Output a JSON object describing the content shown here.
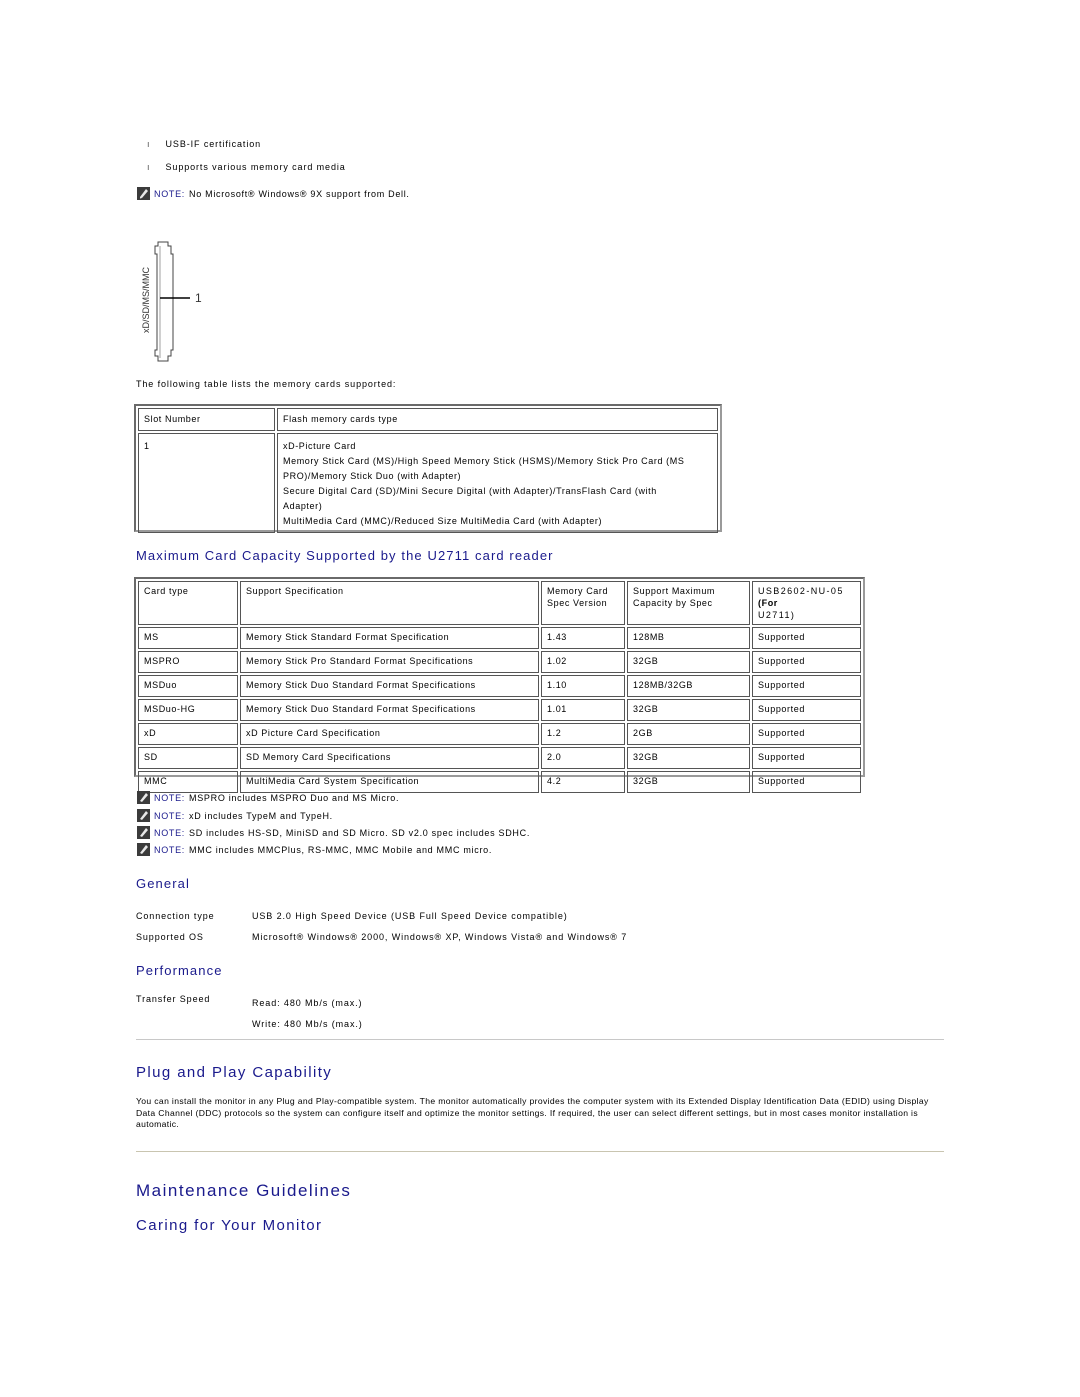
{
  "features": {
    "bullets": [
      "USB-IF certification",
      "Supports various memory card media"
    ],
    "note_label": "NOTE:",
    "note_text": "No Microsoft® Windows® 9X support from Dell."
  },
  "diagram": {
    "slot_label": "xD/SD/MS/MMC",
    "callout": "1"
  },
  "slot_table": {
    "intro": "The following table lists the memory cards supported:",
    "headers": [
      "Slot Number",
      "Flash memory cards type"
    ],
    "slot": "1",
    "card_lines": [
      "xD-Picture Card",
      "Memory Stick Card (MS)/High Speed Memory Stick (HSMS)/Memory Stick Pro Card (MS",
      "PRO)/Memory Stick Duo (with Adapter)",
      "Secure Digital Card (SD)/Mini Secure Digital (with Adapter)/TransFlash Card (with",
      "Adapter)",
      "MultiMedia Card (MMC)/Reduced Size MultiMedia Card (with Adapter)"
    ]
  },
  "capacity": {
    "title": "Maximum Card Capacity Supported by the U2711 card reader",
    "headers": {
      "card_type": "Card type",
      "spec": "Support Specification",
      "version_1": "Memory Card",
      "version_2": "Spec Version",
      "max_1": "Support Maximum",
      "max_2": "Capacity by Spec",
      "usb_1": "USB2602-NU-05",
      "usb_2": "(For",
      "usb_3": "U2711)"
    },
    "rows": [
      {
        "type": "MS",
        "spec": "Memory Stick Standard Format Specification",
        "version": "1.43",
        "max": "128MB",
        "status": "Supported"
      },
      {
        "type": "MSPRO",
        "spec": "Memory Stick Pro Standard Format Specifications",
        "version": "1.02",
        "max": "32GB",
        "status": "Supported"
      },
      {
        "type": "MSDuo",
        "spec": "Memory Stick Duo Standard Format Specifications",
        "version": "1.10",
        "max": "128MB/32GB",
        "status": "Supported"
      },
      {
        "type": "MSDuo-HG",
        "spec": "Memory Stick Duo Standard Format Specifications",
        "version": "1.01",
        "max": "32GB",
        "status": "Supported"
      },
      {
        "type": "xD",
        "spec": "xD Picture Card Specification",
        "version": "1.2",
        "max": "2GB",
        "status": "Supported"
      },
      {
        "type": "SD",
        "spec": "SD Memory Card Specifications",
        "version": "2.0",
        "max": "32GB",
        "status": "Supported"
      },
      {
        "type": "MMC",
        "spec": "MultiMedia Card System Specification",
        "version": "4.2",
        "max": "32GB",
        "status": "Supported"
      }
    ],
    "notes": [
      "MSPRO includes MSPRO Duo and MS Micro.",
      "xD includes TypeM and TypeH.",
      "SD includes HS-SD, MiniSD and SD Micro. SD v2.0 spec includes SDHC.",
      "MMC includes MMCPlus, RS-MMC, MMC Mobile and MMC micro."
    ]
  },
  "general": {
    "title": "General",
    "connection_label": "Connection type",
    "connection_value": "USB 2.0 High Speed Device (USB Full Speed Device compatible)",
    "os_label": "Supported OS",
    "os_value": "Microsoft® Windows® 2000, Windows® XP, Windows Vista® and Windows® 7"
  },
  "performance": {
    "title": "Performance",
    "speed_label": "Transfer Speed",
    "read": "Read: 480 Mb/s (max.)",
    "write": "Write: 480 Mb/s (max.)"
  },
  "plug_and_play": {
    "title": "Plug and Play Capability",
    "body": "You can install the monitor in any Plug and Play-compatible system. The monitor automatically provides the computer system with its Extended Display Identification Data (EDID) using Display Data Channel (DDC) protocols so the system can configure itself and optimize the monitor settings. If required, the user can select different settings, but in most cases monitor installation is automatic."
  },
  "maintenance": {
    "title": "Maintenance Guidelines",
    "subtitle": "Caring for Your Monitor"
  }
}
